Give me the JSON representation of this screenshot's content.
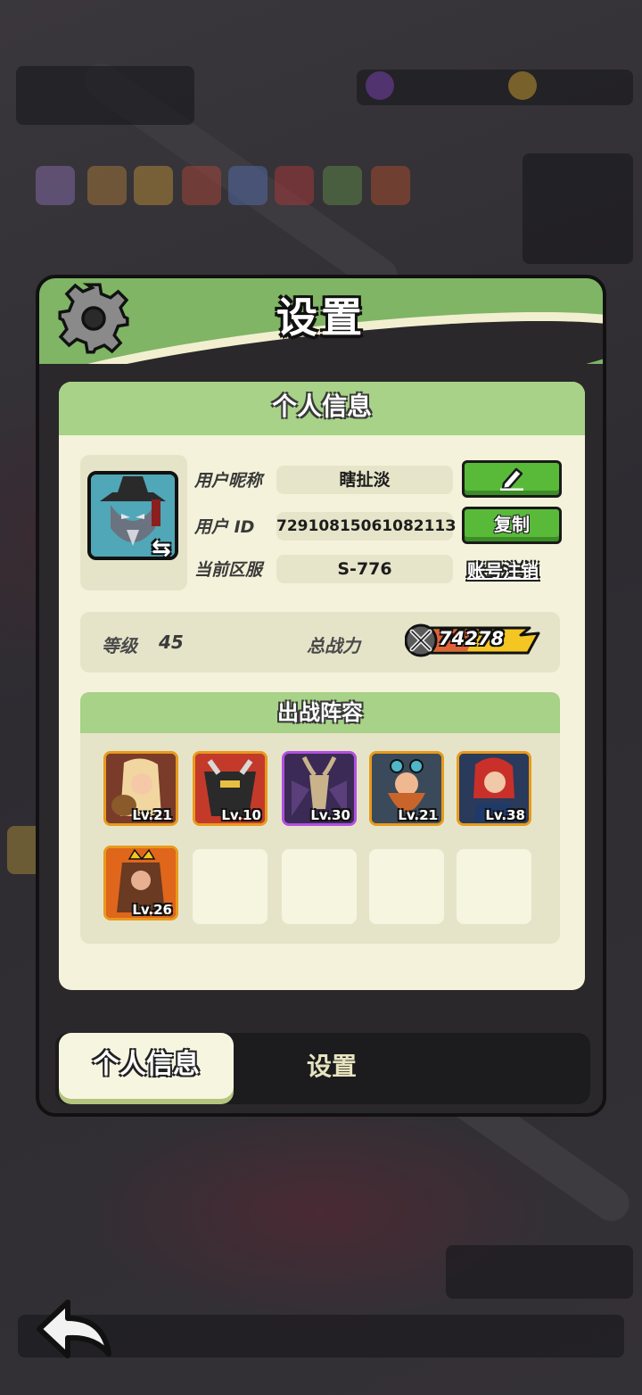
{
  "dialog": {
    "title": "设置",
    "tabs": [
      {
        "label": "个人信息",
        "active": true
      },
      {
        "label": "设置",
        "active": false
      }
    ]
  },
  "profile": {
    "section_title": "个人信息",
    "nickname_label": "用户昵称",
    "nickname_value": "瞎扯淡",
    "id_label": "用户 ID",
    "id_value": "7291081506108211З",
    "server_label": "当前区服",
    "server_value": "S-776",
    "copy_label": "复制",
    "cancel_account_label": "账号注销",
    "edit_icon": "pencil-icon",
    "swap_icon": "swap-arrows-icon"
  },
  "stats": {
    "level_label": "等级",
    "level_value": "45",
    "power_label": "总战力",
    "power_value": "74278",
    "power_icon": "crossed-swords-icon"
  },
  "lineup": {
    "title": "出战阵容",
    "heroes": [
      {
        "level": "Lv.21",
        "rarity": "orange",
        "colors": [
          "#7a3b2a",
          "#f1d6a0"
        ]
      },
      {
        "level": "Lv.10",
        "rarity": "orange",
        "colors": [
          "#2a2a2a",
          "#c43a2a"
        ]
      },
      {
        "level": "Lv.30",
        "rarity": "purple",
        "colors": [
          "#3b2a55",
          "#c9b38a"
        ]
      },
      {
        "level": "Lv.21",
        "rarity": "orange",
        "colors": [
          "#c9652a",
          "#3a4a5a"
        ]
      },
      {
        "level": "Lv.38",
        "rarity": "orange",
        "colors": [
          "#c9302a",
          "#2a3a5a"
        ]
      },
      {
        "level": "Lv.26",
        "rarity": "orange",
        "colors": [
          "#e0661c",
          "#6a3a22"
        ]
      }
    ],
    "empty_slots": 4
  },
  "colors": {
    "header_green": "#7fb565",
    "panel_cream": "#f4f2da",
    "button_green": "#59ba3a",
    "rarity_orange": "#e89a1c",
    "rarity_purple": "#b24fe0",
    "power_bar": "#f3c623"
  }
}
